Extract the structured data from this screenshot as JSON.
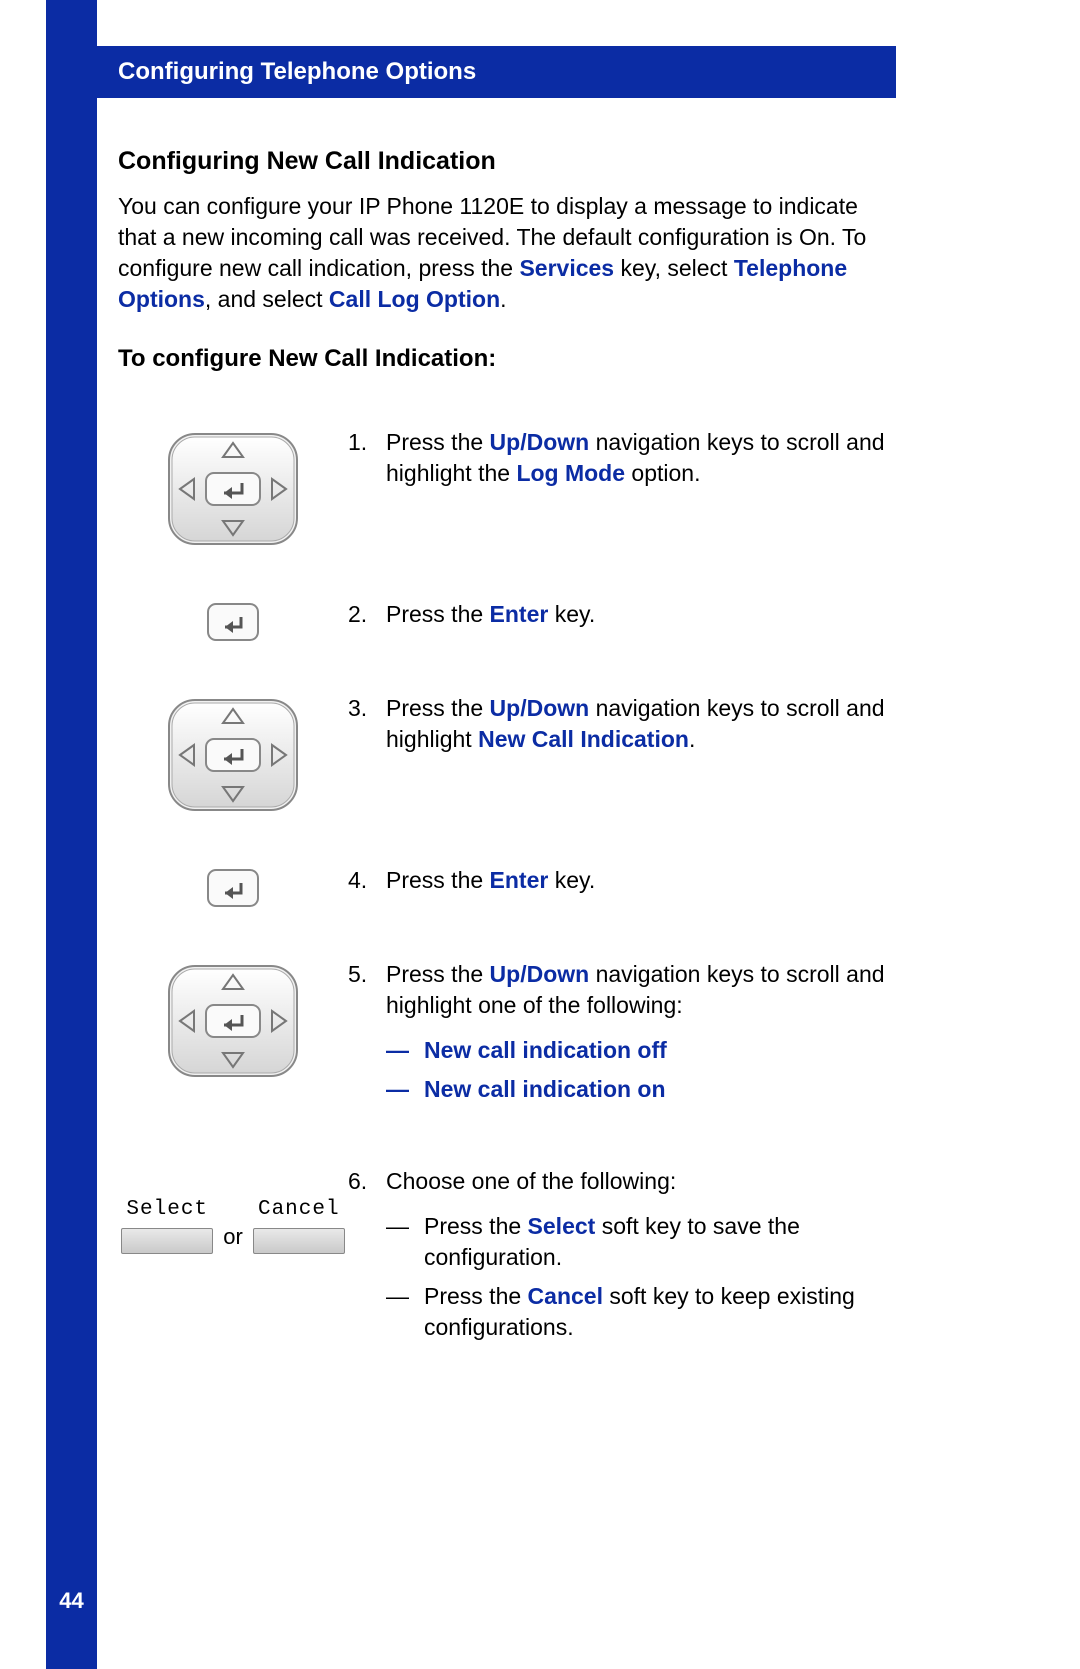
{
  "header": "Configuring Telephone Options",
  "section_title": "Configuring New Call Indication",
  "intro": {
    "t1": "You can configure your IP Phone 1120E to display a message to indicate that a new incoming call was received. The default configuration is On. To configure new call indication, press the ",
    "services": "Services",
    "t2": " key, select ",
    "telopts": "Telephone Options",
    "t3": ", and select ",
    "calllog": "Call Log Option",
    "t4": "."
  },
  "subheading": "To configure New Call Indication:",
  "steps": {
    "s1": {
      "num": "1.",
      "a": "Press the ",
      "updown": "Up/Down",
      "b": " navigation keys to scroll and highlight the ",
      "logmode": "Log Mode",
      "c": " option."
    },
    "s2": {
      "num": "2.",
      "a": "Press the ",
      "enter": "Enter",
      "b": " key."
    },
    "s3": {
      "num": "3.",
      "a": "Press the ",
      "updown": "Up/Down",
      "b": " navigation keys to scroll and highlight ",
      "nci": "New Call Indication",
      "c": "."
    },
    "s4": {
      "num": "4.",
      "a": "Press the ",
      "enter": "Enter",
      "b": " key."
    },
    "s5": {
      "num": "5.",
      "a": "Press the ",
      "updown": "Up/Down",
      "b": " navigation keys to scroll and highlight one of the following:",
      "opt1dash": "—",
      "opt1": "New call indication off",
      "opt2dash": "—",
      "opt2": "New call indication on"
    },
    "s6": {
      "num": "6.",
      "a": "Choose one of the following:",
      "d1dash": "—",
      "d1a": "Press the ",
      "select": "Select",
      "d1b": " soft key to save the configuration.",
      "d2dash": "—",
      "d2a": "Press the ",
      "cancel": "Cancel",
      "d2b": " soft key to keep existing configurations."
    }
  },
  "softkeys": {
    "select": "Select",
    "or": "or",
    "cancel": "Cancel"
  },
  "page_number": "44"
}
